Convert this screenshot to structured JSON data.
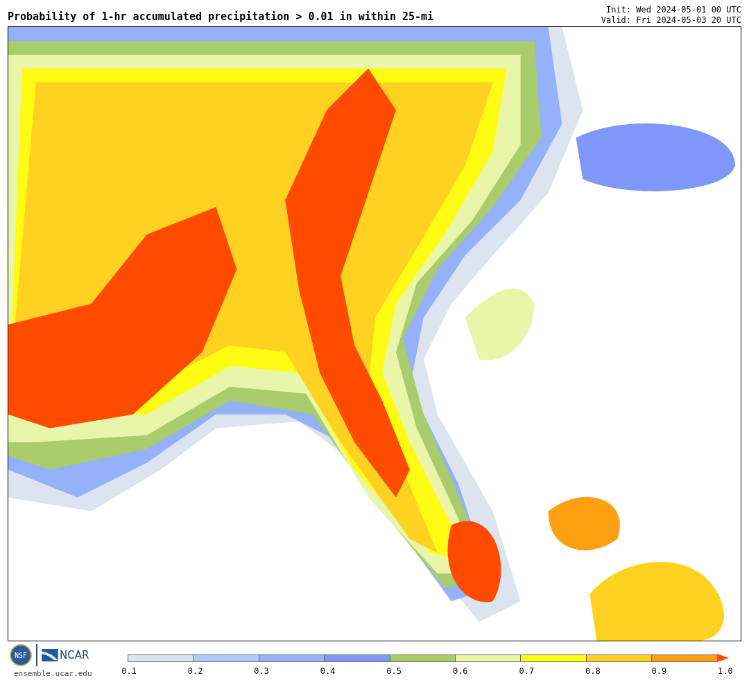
{
  "title": "Probability of 1-hr accumulated precipitation > 0.01 in within 25-mi",
  "init": "Init: Wed 2024-05-01 00 UTC",
  "valid": "Valid: Fri 2024-05-03 20 UTC",
  "logos": {
    "nsf": "NSF",
    "ncar": "NCAR",
    "url": "ensemble.ucar.edu"
  },
  "legend": {
    "segments": [
      {
        "color": "#dce5ef"
      },
      {
        "color": "#b5c9f9"
      },
      {
        "color": "#94b1fa"
      },
      {
        "color": "#7e97f8"
      },
      {
        "color": "#a9cd6d"
      },
      {
        "color": "#e9f6a9"
      },
      {
        "color": "#fffb13"
      },
      {
        "color": "#ffd222"
      },
      {
        "color": "#ff9f12"
      },
      {
        "kind": "arrow",
        "color": "#ff4b00"
      }
    ],
    "ticks": [
      "0.1",
      "0.2",
      "0.3",
      "0.4",
      "0.5",
      "0.6",
      "0.7",
      "0.8",
      "0.9",
      "1.0"
    ]
  }
}
